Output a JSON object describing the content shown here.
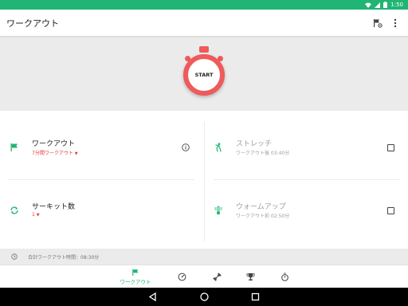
{
  "status_bar": {
    "time": "1:50"
  },
  "app_bar": {
    "title": "ワークアウト"
  },
  "hero": {
    "start_label": "START"
  },
  "settings": {
    "workout": {
      "title": "ワークアウト",
      "value": "7分間ワークアウト"
    },
    "circuits": {
      "title": "サーキット数",
      "value": "1"
    },
    "stretch": {
      "title": "ストレッチ",
      "detail": "ワークアウト後 03:40分",
      "checked": false
    },
    "warmup": {
      "title": "ウォームアップ",
      "detail": "ワークアウト前 02:50分",
      "checked": false
    }
  },
  "total": {
    "text": "合計ワークアウト時間：08:30分"
  },
  "bottom_nav": {
    "items": [
      {
        "label": "ワークアウト",
        "icon": "flag-icon",
        "active": true
      },
      {
        "label": "",
        "icon": "speedometer-icon",
        "active": false
      },
      {
        "label": "",
        "icon": "dumbbell-icon",
        "active": false
      },
      {
        "label": "",
        "icon": "trophy-icon",
        "active": false
      },
      {
        "label": "",
        "icon": "stopwatch-icon",
        "active": false
      }
    ]
  },
  "colors": {
    "accent": "#20b573",
    "start_ring": "#ef5a5a",
    "value_red": "#e53935",
    "disabled": "#9e9e9e"
  }
}
